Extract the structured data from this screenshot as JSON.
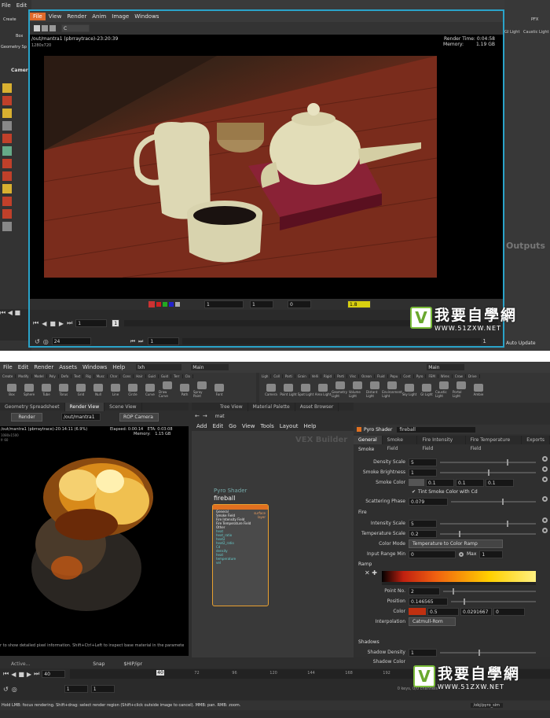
{
  "top": {
    "app_menu": [
      "File",
      "Edit"
    ],
    "create_label": "Create",
    "box_label": "Box",
    "geo_tab": "Geometry Sp",
    "camera_tab": "Camer",
    "render_view": {
      "menu": [
        "File",
        "View",
        "Render",
        "Anim",
        "Image",
        "Windows"
      ],
      "channel": "C",
      "path": "/out/mantra1 (pbrraytrace)-23:20:39",
      "resolution": "1280x720",
      "render_time_label": "Render Time:",
      "render_time": "0:04:58",
      "memory_label": "Memory:",
      "memory": "1.19 GB",
      "frame_fields": [
        "1",
        "1",
        "0",
        "1.8"
      ],
      "playbar_frame": "1",
      "playbar_end": "1",
      "range_start": "24",
      "range_frame": "1",
      "range_end": "1",
      "frame_marker": "1"
    },
    "right": {
      "pfx": "PFX",
      "tools": [
        "GI Light",
        "Caustic Light"
      ],
      "outputs": "Outputs",
      "auto_update": "Auto Update"
    }
  },
  "bottom": {
    "menu": [
      "File",
      "Edit",
      "Render",
      "Assets",
      "Windows",
      "Help"
    ],
    "desktop": "lxh",
    "main": "Main",
    "main_right": "Main",
    "shelf_tabs_left": [
      "Create",
      "Modify",
      "Model",
      "Poly",
      "Defo",
      "Text",
      "Rig",
      "Musc",
      "Char",
      "Cons",
      "Hair",
      "Guid",
      "Guid",
      "Terr",
      "Clo"
    ],
    "shelf_tabs_right": [
      "Ligh",
      "Coll",
      "Parti",
      "Grain",
      "Velli",
      "Rigid",
      "Parti",
      "Visc",
      "Ocean",
      "Fluid",
      "Popu",
      "Cont",
      "Pyro",
      "FEM",
      "Wires",
      "Crow",
      "Drive"
    ],
    "shelf_tools_left": [
      "Box",
      "Sphere",
      "Tube",
      "Torus",
      "Grid",
      "Null",
      "Line",
      "Circle",
      "Curve",
      "Draw Curve",
      "Path",
      "Spray Paint",
      "Font"
    ],
    "shelf_tools_right": [
      "Camera",
      "Point Light",
      "Spot Light",
      "Area Light",
      "Geometry Light",
      "Volume Light",
      "Distant Light",
      "Environment Light",
      "Sky Light",
      "GI Light",
      "Caustic Light",
      "Portal Light",
      "Ambie"
    ],
    "panel_tabs_left": [
      "Geometry Spreadsheet",
      "Render View",
      "Scene View"
    ],
    "panel_tabs_right": [
      "Tree View",
      "Material Palette",
      "Asset Browser"
    ],
    "render_button": "Render",
    "out_path": "/out/mantra1",
    "rop_camera": "ROP Camera",
    "render_status": "/out/mantra1 (pbrraytrace)-20:14:11 (6.9%)",
    "elapsed": "Elapsed: 0:00:14",
    "eta": "ETA: 0:03:08",
    "memory": "Memory:",
    "memory_val": "1.15 GB",
    "res": "1080x1500",
    "fr": "fr 60",
    "hint": "r to show detailed pixel information. Shift+Ctrl+Left to inspect base material in the paramete",
    "active": "Active...",
    "snap": "Snap",
    "hip": "$HIP/ipr",
    "net_path": "mat",
    "net_menu": [
      "Add",
      "Edit",
      "Go",
      "View",
      "Tools",
      "Layout",
      "Help"
    ],
    "vex_builder": "VEX Builder",
    "node": {
      "type": "Pyro Shader",
      "name": "fireball",
      "inputs": [
        "General",
        "Smoke Field",
        "Fire Intensity Field",
        "Fire Temperature Field",
        "Other",
        "heat",
        "heat_ratio",
        "heat2",
        "heat2_ratio",
        "Cd",
        "density",
        "heat",
        "temperature",
        "vel"
      ],
      "outputs": [
        "surface",
        "layer"
      ]
    },
    "params": {
      "type": "Pyro Shader",
      "name": "fireball",
      "tabs": [
        "General",
        "Smoke Field",
        "Fire Intensity Field",
        "Fire Temperature Field",
        "Exports"
      ],
      "smoke_section": "Smoke",
      "density_scale_label": "Density Scale",
      "density_scale": "5",
      "smoke_brightness_label": "Smoke Brightness",
      "smoke_brightness": "1",
      "smoke_color_label": "Smoke Color",
      "smoke_color": [
        "0.1",
        "0.1",
        "0.1"
      ],
      "tint_label": "Tint Smoke Color with Cd",
      "scatter_label": "Scattering Phase",
      "scatter": "0.079",
      "fire_section": "Fire",
      "intensity_label": "Intensity Scale",
      "intensity": "5",
      "temp_scale_label": "Temperature Scale",
      "temp_scale": "0.2",
      "color_mode_label": "Color Mode",
      "color_mode": "Temperature to Color Ramp",
      "input_range_label": "Input Range Min",
      "input_range_min": "0",
      "max_label": "Max",
      "input_range_max": "1",
      "ramp_section": "Ramp",
      "point_no_label": "Point No.",
      "point_no": "2",
      "position_label": "Position",
      "position": "0.146565",
      "color_label": "Color",
      "color_vals": [
        "0.5",
        "0.0291667",
        "0"
      ],
      "interp_label": "Interpolation",
      "interp": "Catmull-Rom",
      "shadows_section": "Shadows",
      "shadow_density_label": "Shadow Density",
      "shadow_density": "1",
      "shadow_color_label": "Shadow Color"
    },
    "timeline": {
      "frame": "40",
      "ticks": [
        "40",
        "72",
        "96",
        "120",
        "144",
        "168",
        "192"
      ],
      "marker": "40",
      "start": "1",
      "end": "1",
      "keys": "0 keys, 0/0 channels",
      "obj": "/obj/pyro_sim"
    },
    "status_bar": "Hold LMB: focus rendering. Shift+drag: select render region (Shift+click outside image to cancel). MMB: pan. RMB: zoom."
  },
  "watermark": {
    "main": "我要自學網",
    "url": "WWW.51ZXW.NET"
  },
  "colors": {
    "accent": "#e06a2a",
    "frame_border": "#2aa3c9"
  }
}
